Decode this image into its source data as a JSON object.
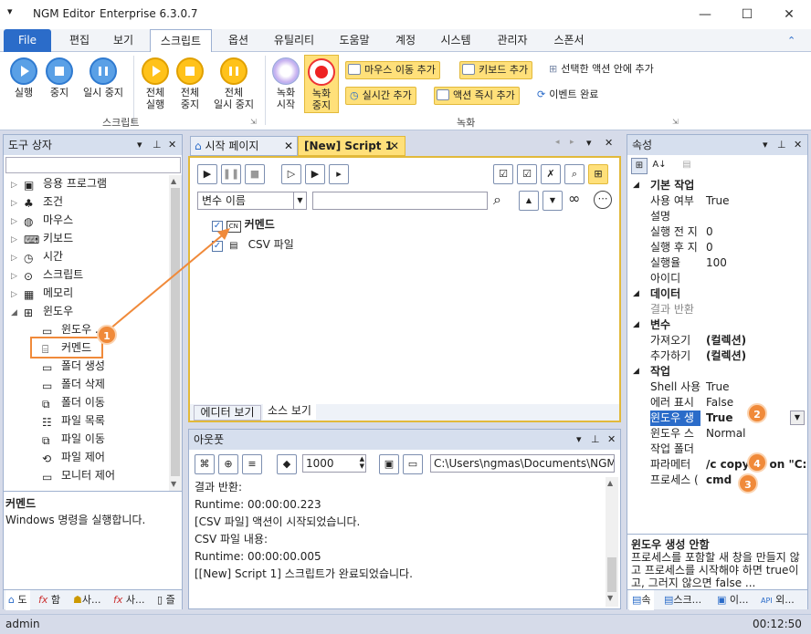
{
  "app": {
    "title": "NGM Editor",
    "edition": "Enterprise 6.3.0.7",
    "status_user": "admin",
    "status_time": "00:12:50"
  },
  "menu": [
    "File",
    "편집",
    "보기",
    "스크립트",
    "옵션",
    "유틸리티",
    "도움말",
    "계정",
    "시스템",
    "관리자",
    "스폰서"
  ],
  "ribbon": {
    "run": "실행",
    "stop": "중지",
    "pause": "일시 중지",
    "run_all_1": "전체",
    "run_all_2": "실행",
    "stop_all_1": "전체",
    "stop_all_2": "중지",
    "pause_all_1": "전체",
    "pause_all_2": "일시 중지",
    "group_script": "스크립트",
    "rec_start_1": "녹화",
    "rec_start_2": "시작",
    "rec_stop_1": "녹화",
    "rec_stop_2": "중지",
    "add_mouse": "마우스 이동 추가",
    "add_keyboard": "키보드 추가",
    "add_in_selected": "선택한 액션 안에 추가",
    "add_realtime": "실시간 추가",
    "add_action_now": "액션 즉시 추가",
    "event_done": "이벤트 완료",
    "group_record": "녹화"
  },
  "toolbox": {
    "title": "도구 상자",
    "items": [
      "응용 프로그램",
      "조건",
      "마우스",
      "키보드",
      "시간",
      "스크립트",
      "메모리",
      "윈도우"
    ],
    "children": [
      "윈도우 ...",
      "커멘드",
      "폴더 생성",
      "폴더 삭제",
      "폴더 이동",
      "파일 목록",
      "파일 이동",
      "파일 제어",
      "모니터 제어"
    ],
    "desc_title": "커멘드",
    "desc_text": "Windows 명령을 실행합니다.",
    "bottom_tabs": [
      "도",
      "함",
      "사...",
      "사...",
      "즐"
    ]
  },
  "doc_tabs": {
    "start": "시작 페이지",
    "script": "[New] Script 1"
  },
  "editor": {
    "var_dropdown": "변수 이름",
    "actions": [
      "커멘드",
      "CSV 파일"
    ],
    "view_tabs": [
      "에디터 보기",
      "소스 보기"
    ]
  },
  "output": {
    "title": "아웃풋",
    "count": "1000",
    "path": "C:\\Users\\ngmas\\Documents\\NGM6\\",
    "lines": [
      "결과 반환:",
      "Runtime: 00:00:00.223",
      "[CSV 파일] 액션이 시작되었습니다.",
      "CSV 파일 내용:",
      "Runtime: 00:00:00.005",
      "[[New] Script 1] 스크립트가 완료되었습니다."
    ]
  },
  "properties": {
    "title": "속성",
    "cats": [
      {
        "name": "기본 작업",
        "rows": [
          [
            "사용 여부",
            "True"
          ],
          [
            "설명",
            ""
          ],
          [
            "실행 전 지",
            "0"
          ],
          [
            "실행 후 지",
            "0"
          ],
          [
            "실행율",
            "100"
          ],
          [
            "아이디",
            ""
          ]
        ]
      },
      {
        "name": "데이터",
        "rows": [
          [
            "결과 반환",
            ""
          ]
        ]
      },
      {
        "name": "변수",
        "rows": [
          [
            "가져오기",
            "(컬렉션)"
          ],
          [
            "추가하기",
            "(컬렉션)"
          ]
        ]
      },
      {
        "name": "작업",
        "rows": [
          [
            "Shell 사용",
            "True"
          ],
          [
            "에러 표시",
            "False"
          ],
          [
            "윈도우 생",
            "True"
          ],
          [
            "윈도우 스",
            "Normal"
          ],
          [
            "작업 폴더",
            ""
          ],
          [
            "파라메터",
            "/c copy ... on \"C:\\"
          ],
          [
            "프로세스 (",
            "cmd"
          ]
        ]
      }
    ],
    "help_title": "윈도우 생성 안함",
    "help_text": "프로세스를 포함할 새 창을 만들지 않고 프로세스를 시작해야 하면 true이고, 그러지 않으면 false ...",
    "bottom_tabs": [
      "속",
      "스크...",
      "이...",
      "외..."
    ]
  },
  "badges": [
    "1",
    "2",
    "3",
    "4"
  ],
  "colors": {
    "accent": "#2b6cc9",
    "badge": "#f08a3a",
    "ribbon_highlight": "#ffe07a"
  }
}
